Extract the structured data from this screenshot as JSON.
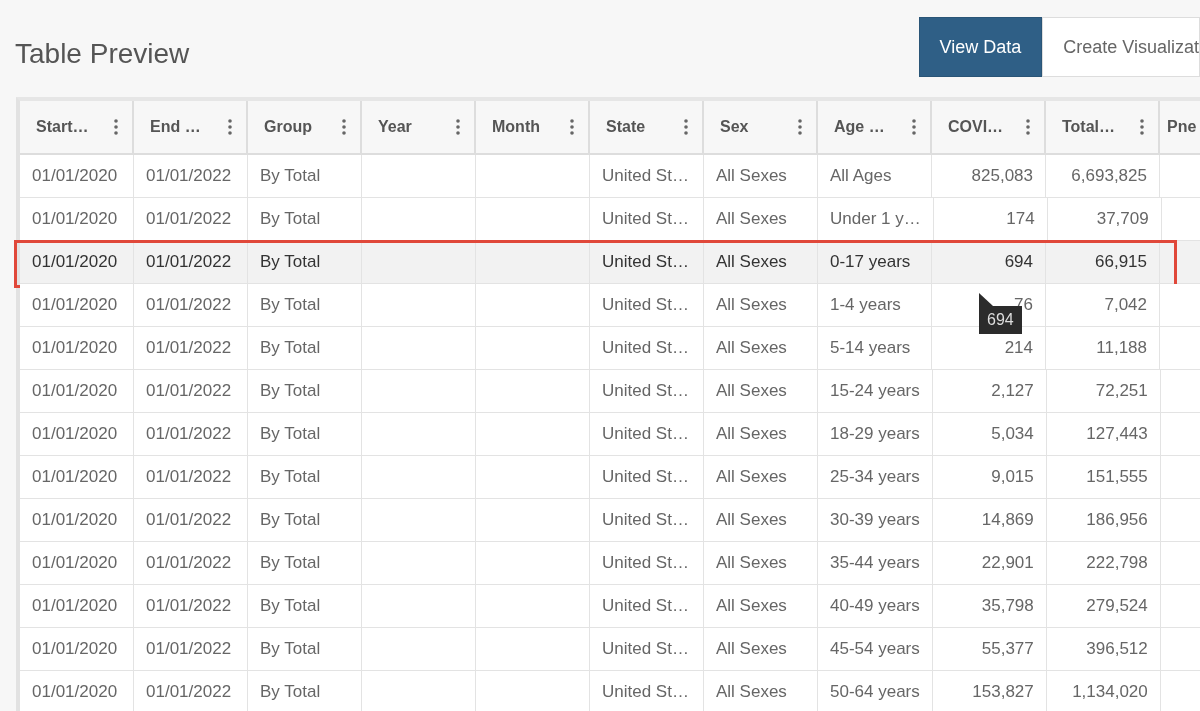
{
  "title": "Table Preview",
  "view_buttons": [
    {
      "label": "View Data",
      "selected": true
    },
    {
      "label": "Create Visualizat",
      "selected": false
    }
  ],
  "table": {
    "columns": [
      {
        "label": "Start…",
        "kind": "text"
      },
      {
        "label": "End …",
        "kind": "text"
      },
      {
        "label": "Group",
        "kind": "text"
      },
      {
        "label": "Year",
        "kind": "text"
      },
      {
        "label": "Month",
        "kind": "text"
      },
      {
        "label": "State",
        "kind": "text"
      },
      {
        "label": "Sex",
        "kind": "text"
      },
      {
        "label": "Age …",
        "kind": "text"
      },
      {
        "label": "COVI…",
        "kind": "number"
      },
      {
        "label": "Total…",
        "kind": "number"
      },
      {
        "label": "Pne",
        "kind": "text"
      }
    ],
    "rows": [
      {
        "selected": false,
        "cells": [
          "01/01/2020",
          "01/01/2022",
          "By Total",
          "",
          "",
          "United St…",
          "All Sexes",
          "All Ages",
          "825,083",
          "6,693,825",
          ""
        ]
      },
      {
        "selected": false,
        "cells": [
          "01/01/2020",
          "01/01/2022",
          "By Total",
          "",
          "",
          "United St…",
          "All Sexes",
          "Under 1 y…",
          "174",
          "37,709",
          ""
        ]
      },
      {
        "selected": true,
        "cells": [
          "01/01/2020",
          "01/01/2022",
          "By Total",
          "",
          "",
          "United St…",
          "All Sexes",
          "0-17 years",
          "694",
          "66,915",
          ""
        ]
      },
      {
        "selected": false,
        "tooltip": "694",
        "cells": [
          "01/01/2020",
          "01/01/2022",
          "By Total",
          "",
          "",
          "United St…",
          "All Sexes",
          "1-4 years",
          "76",
          "7,042",
          ""
        ]
      },
      {
        "selected": false,
        "cells": [
          "01/01/2020",
          "01/01/2022",
          "By Total",
          "",
          "",
          "United St…",
          "All Sexes",
          "5-14 years",
          "214",
          "11,188",
          ""
        ]
      },
      {
        "selected": false,
        "cells": [
          "01/01/2020",
          "01/01/2022",
          "By Total",
          "",
          "",
          "United St…",
          "All Sexes",
          "15-24 years",
          "2,127",
          "72,251",
          ""
        ]
      },
      {
        "selected": false,
        "cells": [
          "01/01/2020",
          "01/01/2022",
          "By Total",
          "",
          "",
          "United St…",
          "All Sexes",
          "18-29 years",
          "5,034",
          "127,443",
          ""
        ]
      },
      {
        "selected": false,
        "cells": [
          "01/01/2020",
          "01/01/2022",
          "By Total",
          "",
          "",
          "United St…",
          "All Sexes",
          "25-34 years",
          "9,015",
          "151,555",
          ""
        ]
      },
      {
        "selected": false,
        "cells": [
          "01/01/2020",
          "01/01/2022",
          "By Total",
          "",
          "",
          "United St…",
          "All Sexes",
          "30-39 years",
          "14,869",
          "186,956",
          ""
        ]
      },
      {
        "selected": false,
        "cells": [
          "01/01/2020",
          "01/01/2022",
          "By Total",
          "",
          "",
          "United St…",
          "All Sexes",
          "35-44 years",
          "22,901",
          "222,798",
          ""
        ]
      },
      {
        "selected": false,
        "cells": [
          "01/01/2020",
          "01/01/2022",
          "By Total",
          "",
          "",
          "United St…",
          "All Sexes",
          "40-49 years",
          "35,798",
          "279,524",
          ""
        ]
      },
      {
        "selected": false,
        "cells": [
          "01/01/2020",
          "01/01/2022",
          "By Total",
          "",
          "",
          "United St…",
          "All Sexes",
          "45-54 years",
          "55,377",
          "396,512",
          ""
        ]
      },
      {
        "selected": false,
        "cells": [
          "01/01/2020",
          "01/01/2022",
          "By Total",
          "",
          "",
          "United St…",
          "All Sexes",
          "50-64 years",
          "153,827",
          "1,134,020",
          ""
        ]
      }
    ]
  }
}
